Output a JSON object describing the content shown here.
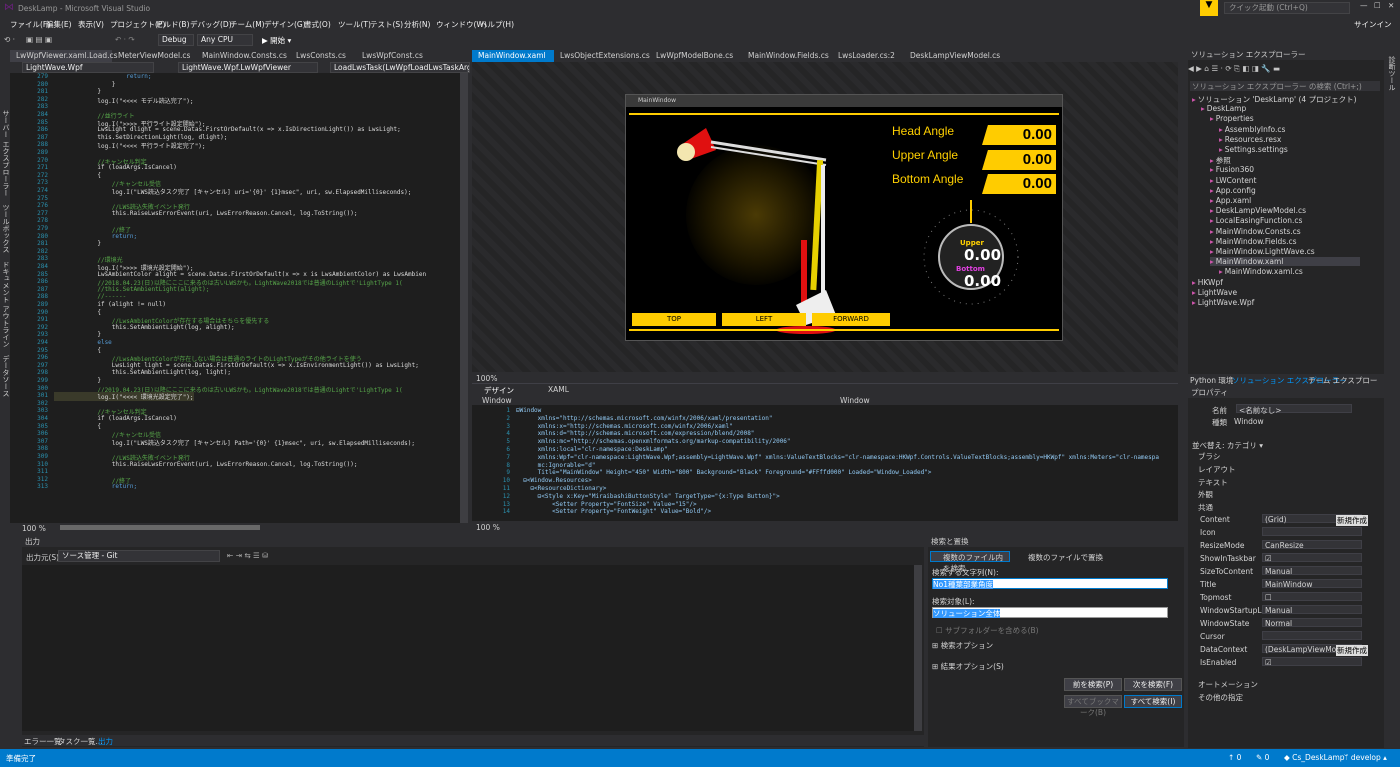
{
  "app": {
    "title": "DeskLamp - Microsoft Visual Studio",
    "quick_launch": "クイック起動 (Ctrl+Q)",
    "signin": "サインイン"
  },
  "menu": [
    "ファイル(F)",
    "編集(E)",
    "表示(V)",
    "プロジェクト(P)",
    "ビルド(B)",
    "デバッグ(D)",
    "チーム(M)",
    "デザイン(G)",
    "書式(O)",
    "ツール(T)",
    "テスト(S)",
    "分析(N)",
    "ウィンドウ(W)",
    "ヘルプ(H)"
  ],
  "toolbar": {
    "config": "Debug",
    "platform": "Any CPU",
    "start": "▶ 開始 ▾"
  },
  "left_vtabs": [
    "サーバー エクスプローラー",
    "ツールボックス",
    "ドキュメント アウトライン",
    "データソース"
  ],
  "right_vtabs": [
    "診断ツール"
  ],
  "left_tabs": [
    "LwWpfViewer.xaml.Load.cs",
    "MeterViewModel.cs",
    "MainWindow.Consts.cs",
    "LwsConsts.cs",
    "LwsWpfConst.cs"
  ],
  "left_nav": {
    "project": "LightWave.Wpf",
    "class": "LightWave.Wpf.LwWpfViewer",
    "member": "LoadLwsTask(LwWpfLoadLwsTaskArgs loadAr"
  },
  "mid_tabs": [
    "MainWindow.xaml",
    "LwsObjectExtensions.cs",
    "LwWpfModelBone.cs",
    "MainWindow.Fields.cs",
    "LwsLoader.cs:2",
    "DeskLampViewModel.cs"
  ],
  "code_lines": [
    {
      "n": "279",
      "t": "                    return;",
      "c": "c-kw"
    },
    {
      "n": "280",
      "t": "                }",
      "c": "c-gray"
    },
    {
      "n": "281",
      "t": "            }",
      "c": "c-gray"
    },
    {
      "n": "282",
      "t": "            log.I(\"<<<< モデル読込完了\");",
      "c": "c-gray"
    },
    {
      "n": "283",
      "t": "",
      "c": "c-gray"
    },
    {
      "n": "284",
      "t": "            //並行ライト",
      "c": "c-com"
    },
    {
      "n": "285",
      "t": "            log.I(\">>>> 平行ライト設定開始\");",
      "c": "c-gray"
    },
    {
      "n": "286",
      "t": "            LwsLight dlight = scene.Datas.FirstOrDefault(x => x.IsDirectionLight()) as LwsLight;",
      "c": "c-gray"
    },
    {
      "n": "287",
      "t": "            this.SetDirectionLight(log, dlight);",
      "c": "c-gray"
    },
    {
      "n": "288",
      "t": "            log.I(\"<<<< 平行ライト設定完了\");",
      "c": "c-gray"
    },
    {
      "n": "289",
      "t": "",
      "c": "c-gray"
    },
    {
      "n": "270",
      "t": "            //キャンセル判定",
      "c": "c-com"
    },
    {
      "n": "271",
      "t": "            if (loadArgs.IsCancel)",
      "c": "c-gray"
    },
    {
      "n": "272",
      "t": "            {",
      "c": "c-gray"
    },
    {
      "n": "273",
      "t": "                //キャンセル受信",
      "c": "c-com"
    },
    {
      "n": "274",
      "t": "                log.I(\"LWS読込タスク完了 [キャンセル] uri='{0}' {1}msec\", uri, sw.ElapsedMilliseconds);",
      "c": "c-gray"
    },
    {
      "n": "275",
      "t": "",
      "c": "c-gray"
    },
    {
      "n": "276",
      "t": "                //LWS読込失敗イベント発行",
      "c": "c-com"
    },
    {
      "n": "277",
      "t": "                this.RaiseLwsErrorEvent(uri, LwsErrorReason.Cancel, log.ToString());",
      "c": "c-gray"
    },
    {
      "n": "278",
      "t": "",
      "c": "c-gray"
    },
    {
      "n": "279",
      "t": "                //終了",
      "c": "c-com"
    },
    {
      "n": "280",
      "t": "                return;",
      "c": "c-kw"
    },
    {
      "n": "281",
      "t": "            }",
      "c": "c-gray"
    },
    {
      "n": "282",
      "t": "",
      "c": "c-gray"
    },
    {
      "n": "283",
      "t": "            //環境光",
      "c": "c-com"
    },
    {
      "n": "284",
      "t": "            log.I(\">>>> 環境光設定開始\");",
      "c": "c-gray"
    },
    {
      "n": "285",
      "t": "            LwsAmbientColor alight = scene.Datas.FirstOrDefault(x => x is LwsAmbientColor) as LwsAmbien",
      "c": "c-gray"
    },
    {
      "n": "286",
      "t": "            //2018.04.23(日)以降にここに来るのは古いLWSかも。LightWave2018では普通のLightで'LightType 1(",
      "c": "c-com"
    },
    {
      "n": "287",
      "t": "            //this.SetAmbientLight(alight);",
      "c": "c-com"
    },
    {
      "n": "288",
      "t": "            //------",
      "c": "c-com"
    },
    {
      "n": "289",
      "t": "            if (alight != null)",
      "c": "c-gray"
    },
    {
      "n": "290",
      "t": "            {",
      "c": "c-gray"
    },
    {
      "n": "291",
      "t": "                //LwsAmbientColorが存在する場合はそちらを優先する",
      "c": "c-com"
    },
    {
      "n": "292",
      "t": "                this.SetAmbientLight(log, alight);",
      "c": "c-gray"
    },
    {
      "n": "293",
      "t": "            }",
      "c": "c-gray"
    },
    {
      "n": "294",
      "t": "            else",
      "c": "c-kw"
    },
    {
      "n": "295",
      "t": "            {",
      "c": "c-gray"
    },
    {
      "n": "296",
      "t": "                //LwsAmbientColorが存在しない場合は普通のライトのLightTypeがその他ライトを使う",
      "c": "c-com"
    },
    {
      "n": "297",
      "t": "                LwsLight light = scene.Datas.FirstOrDefault(x => x.IsEnvironmentLight()) as LwsLight;",
      "c": "c-gray"
    },
    {
      "n": "298",
      "t": "                this.SetAmbientLight(log, light);",
      "c": "c-gray"
    },
    {
      "n": "299",
      "t": "            }",
      "c": "c-gray"
    },
    {
      "n": "300",
      "t": "            //2019.04.23(日)以降にここに来るのは古いLWSかも。LightWave2018では普通のLightで'LightType 1(",
      "c": "c-com"
    },
    {
      "n": "301",
      "t": "            log.I(\"<<<< 環境光設定完了\");",
      "c": "c-gray"
    },
    {
      "n": "302",
      "t": "",
      "c": "c-gray"
    },
    {
      "n": "303",
      "t": "            //キャンセル判定",
      "c": "c-com"
    },
    {
      "n": "304",
      "t": "            if (loadArgs.IsCancel)",
      "c": "c-gray"
    },
    {
      "n": "305",
      "t": "            {",
      "c": "c-gray"
    },
    {
      "n": "306",
      "t": "                //キャンセル受信",
      "c": "c-com"
    },
    {
      "n": "307",
      "t": "                log.I(\"LWS読込タスク完了 [キャンセル] Path='{0}' {1}msec\", uri, sw.ElapsedMilliseconds);",
      "c": "c-gray"
    },
    {
      "n": "308",
      "t": "",
      "c": "c-gray"
    },
    {
      "n": "309",
      "t": "                //LWS読込失敗イベント発行",
      "c": "c-com"
    },
    {
      "n": "310",
      "t": "                this.RaiseLwsErrorEvent(uri, LwsErrorReason.Cancel, log.ToString());",
      "c": "c-gray"
    },
    {
      "n": "311",
      "t": "",
      "c": "c-gray"
    },
    {
      "n": "312",
      "t": "                //終了",
      "c": "c-com"
    },
    {
      "n": "313",
      "t": "                return;",
      "c": "c-kw"
    }
  ],
  "left_zoom": "100 %",
  "designer": {
    "window_title": "MainWindow",
    "head_angle_label": "Head Angle",
    "upper_angle_label": "Upper Angle",
    "bottom_angle_label": "Bottom Angle",
    "head_angle": "0.00",
    "upper_angle": "0.00",
    "bottom_angle": "0.00",
    "gauge_upper_label": "Upper",
    "gauge_upper": "0.00",
    "gauge_bottom_label": "Bottom",
    "gauge_bottom": "0.00",
    "btn_top": "TOP",
    "btn_left": "LEFT",
    "btn_forward": "FORWARD",
    "zoom": "100%"
  },
  "split_tabs": {
    "design": "デザイン",
    "xaml": "XAML"
  },
  "xaml_nav": {
    "left": "Window",
    "right": "Window"
  },
  "xaml_lines": [
    {
      "n": "1",
      "t": "⊟Window"
    },
    {
      "n": "2",
      "t": "      xmlns=\"http://schemas.microsoft.com/winfx/2006/xaml/presentation\""
    },
    {
      "n": "3",
      "t": "      xmlns:x=\"http://schemas.microsoft.com/winfx/2006/xaml\""
    },
    {
      "n": "4",
      "t": "      xmlns:d=\"http://schemas.microsoft.com/expression/blend/2008\""
    },
    {
      "n": "5",
      "t": "      xmlns:mc=\"http://schemas.openxmlformats.org/markup-compatibility/2006\""
    },
    {
      "n": "6",
      "t": "      xmlns:local=\"clr-namespace:DeskLamp\""
    },
    {
      "n": "7",
      "t": "      xmlns:Wpf=\"clr-namespace:LightWave.Wpf;assembly=LightWave.Wpf\" xmlns:ValueTextBlocks=\"clr-namespace:HKWpf.Controls.ValueTextBlocks;assembly=HKWpf\" xmlns:Meters=\"clr-namespa"
    },
    {
      "n": "8",
      "t": "      mc:Ignorable=\"d\""
    },
    {
      "n": "9",
      "t": "      Title=\"MainWindow\" Height=\"450\" Width=\"800\" Background=\"Black\" Foreground=\"#FFffd000\" Loaded=\"Window_Loaded\">"
    },
    {
      "n": "10",
      "t": "  ⊟<Window.Resources>"
    },
    {
      "n": "11",
      "t": "    ⊟<ResourceDictionary>"
    },
    {
      "n": "12",
      "t": "      ⊟<Style x:Key=\"MiraibashiButtonStyle\" TargetType=\"{x:Type Button}\">"
    },
    {
      "n": "13",
      "t": "          <Setter Property=\"FontSize\" Value=\"15\"/>"
    },
    {
      "n": "14",
      "t": "          <Setter Property=\"FontWeight\" Value=\"Bold\"/>"
    }
  ],
  "xaml_zoom": "100 %",
  "solution": {
    "header": "ソリューション エクスプローラー",
    "search": "ソリューション エクスプローラー の検索 (Ctrl+;)",
    "items": [
      {
        "t": "ソリューション 'DeskLamp' (4 プロジェクト)",
        "l": 0
      },
      {
        "t": "DeskLamp",
        "l": 1
      },
      {
        "t": "Properties",
        "l": 2
      },
      {
        "t": "AssemblyInfo.cs",
        "l": 3
      },
      {
        "t": "Resources.resx",
        "l": 3
      },
      {
        "t": "Settings.settings",
        "l": 3
      },
      {
        "t": "参照",
        "l": 2
      },
      {
        "t": "Fusion360",
        "l": 2
      },
      {
        "t": "LWContent",
        "l": 2
      },
      {
        "t": "App.config",
        "l": 2
      },
      {
        "t": "App.xaml",
        "l": 2
      },
      {
        "t": "DeskLampViewModel.cs",
        "l": 2
      },
      {
        "t": "LocalEasingFunction.cs",
        "l": 2
      },
      {
        "t": "MainWindow.Consts.cs",
        "l": 2
      },
      {
        "t": "MainWindow.Fields.cs",
        "l": 2
      },
      {
        "t": "MainWindow.LightWave.cs",
        "l": 2
      },
      {
        "t": "MainWindow.xaml",
        "l": 2
      },
      {
        "t": "MainWindow.xaml.cs",
        "l": 3
      },
      {
        "t": "HKWpf",
        "l": 0
      },
      {
        "t": "LightWave",
        "l": 0
      },
      {
        "t": "LightWave.Wpf",
        "l": 0
      }
    ],
    "bottom_tabs": [
      "Python 環境",
      "ソリューション エクスプローラー",
      "チーム エクスプローラー"
    ]
  },
  "properties": {
    "header": "プロパティ",
    "name_label": "名前",
    "name_value": "<名前なし>",
    "type_label": "種類",
    "type_value": "Window",
    "arrange": "並べ替え: カテゴリ ▾",
    "cats": [
      "ブラシ",
      "レイアウト",
      "テキスト",
      "外観",
      "共通"
    ],
    "rows": [
      {
        "k": "Content",
        "v": "(Grid)",
        "extra": "新規作成"
      },
      {
        "k": "Icon",
        "v": ""
      },
      {
        "k": "ResizeMode",
        "v": "CanResize"
      },
      {
        "k": "ShowInTaskbar",
        "v": "☑"
      },
      {
        "k": "SizeToContent",
        "v": "Manual"
      },
      {
        "k": "Title",
        "v": "MainWindow"
      },
      {
        "k": "Topmost",
        "v": "☐"
      },
      {
        "k": "WindowStartupLoc...",
        "v": "Manual"
      },
      {
        "k": "WindowState",
        "v": "Normal"
      },
      {
        "k": "Cursor",
        "v": ""
      },
      {
        "k": "DataContext",
        "v": "(DeskLampViewModel)",
        "extra": "新規作成"
      },
      {
        "k": "IsEnabled",
        "v": "☑"
      }
    ],
    "cats2": [
      "オートメーション",
      "その他の指定"
    ]
  },
  "output": {
    "header": "出力",
    "source_label": "出力元(S):",
    "source": "ソース管理 - Git",
    "bottom_tabs": [
      "エラー一覧",
      "タスク一覧...",
      "出力"
    ]
  },
  "find": {
    "header": "検索と置換",
    "tab_find": "複数のファイル内を検索",
    "tab_replace": "複数のファイルで置換",
    "what_label": "検索する文字列(N):",
    "what": "No1種葉部業角度",
    "look_label": "検索対象(L):",
    "look": "ソリューション全体",
    "subfolder": "サブフォルダーを含める(B)",
    "opt1": "検索オプション",
    "opt2": "結果オプション(S)",
    "prev": "前を検索(P)",
    "next": "次を検索(F)",
    "bookmark": "すべてブックマーク(B)",
    "findall": "すべて検索(I)"
  },
  "status": {
    "ready": "準備完了",
    "up": "↑ 0",
    "edit": "✎ 0",
    "repo": "◆ Cs_DeskLamp",
    "branch": "ᛘ develop ▴"
  }
}
